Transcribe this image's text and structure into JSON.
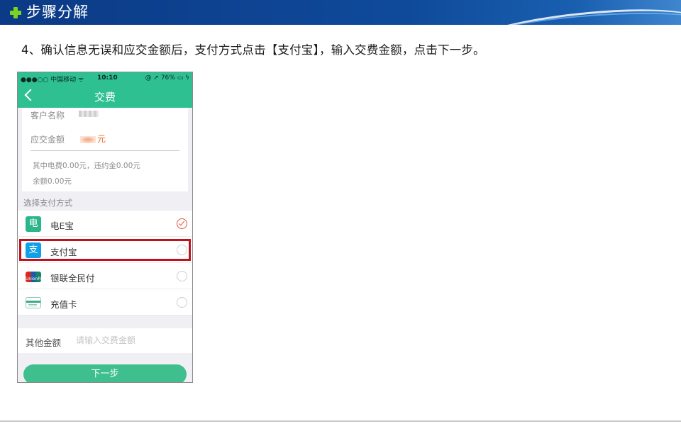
{
  "header": {
    "title": "步骤分解"
  },
  "instruction": "4、确认信息无误和应交金额后，支付方式点击【支付宝】，输入交费金额，点击下一步。",
  "phone": {
    "status_bar": {
      "carrier": "●●●○○ 中国移动 ᯤ",
      "time": "10:10",
      "battery": "@ ➚ 76% ▭ ϟ"
    },
    "nav": {
      "title": "交费"
    },
    "bill": {
      "customer_label": "客户名称",
      "amount_label": "应交金额",
      "amount_unit": "元",
      "fee_note": "其中电费0.00元，违约金0.00元",
      "balance_note": "余额0.00元"
    },
    "pay_section_label": "选择支付方式",
    "pay_methods": [
      {
        "label": "电E宝",
        "icon": "电",
        "checked": true
      },
      {
        "label": "支付宝",
        "icon": "支",
        "checked": false
      },
      {
        "label": "银联全民付",
        "icon": "UnionPay",
        "checked": false
      },
      {
        "label": "充值卡",
        "icon": "card-icon",
        "checked": false
      }
    ],
    "other_amount": {
      "label": "其他金额",
      "placeholder": "请输入交费金额"
    },
    "next_button": "下一步"
  },
  "colors": {
    "brand_green": "#2fc092",
    "header_blue": "#0f4a9a",
    "highlight_red": "#c0121e",
    "amount_orange": "#f0692b"
  }
}
